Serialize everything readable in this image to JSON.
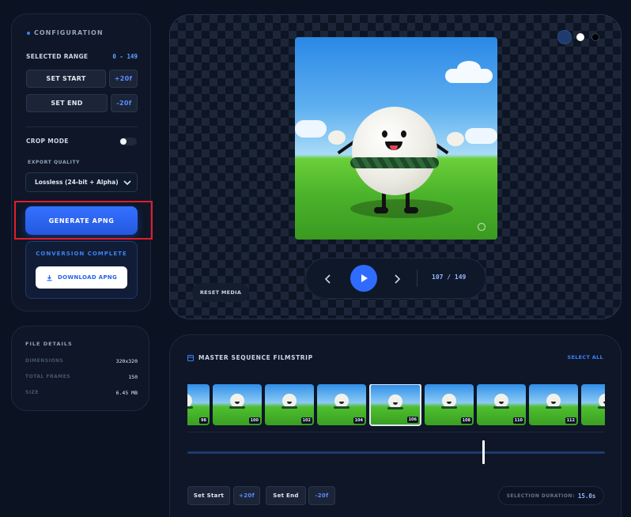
{
  "config": {
    "section_title": "CONFIGURATION",
    "selected_range_label": "SELECTED RANGE",
    "selected_range_value": "0 - 149",
    "set_start_label": "SET START",
    "set_start_offset": "+20f",
    "set_end_label": "SET END",
    "set_end_offset": "-20f",
    "crop_mode_label": "CROP MODE",
    "crop_mode_on": false,
    "export_quality_label": "EXPORT QUALITY",
    "export_quality_value": "Lossless (24-bit + Alpha)",
    "generate_label": "GENERATE APNG",
    "conversion_status": "CONVERSION COMPLETE",
    "download_label": "DOWNLOAD APNG"
  },
  "file_details": {
    "title": "FILE DETAILS",
    "rows": [
      {
        "label": "DIMENSIONS",
        "value": "320x320"
      },
      {
        "label": "TOTAL FRAMES",
        "value": "150"
      },
      {
        "label": "SIZE",
        "value": "6.45 MB"
      }
    ]
  },
  "preview": {
    "reset_label": "RESET MEDIA",
    "frame_counter": "107 / 149",
    "bg_swatches": [
      "#1e3a6e",
      "#ffffff",
      "#000000"
    ]
  },
  "filmstrip": {
    "title": "MASTER SEQUENCE FILMSTRIP",
    "select_all_label": "SELECT ALL",
    "frames": [
      "98",
      "100",
      "102",
      "104",
      "106",
      "108",
      "110",
      "112"
    ],
    "selected_frame": "106",
    "set_start_label": "Set Start",
    "set_start_offset": "+20f",
    "set_end_label": "Set End",
    "set_end_offset": "-20f",
    "duration_label": "SELECTION DURATION:",
    "duration_value": "15.0s"
  },
  "colors": {
    "accent": "#2563eb",
    "highlight": "#e11d2a"
  }
}
